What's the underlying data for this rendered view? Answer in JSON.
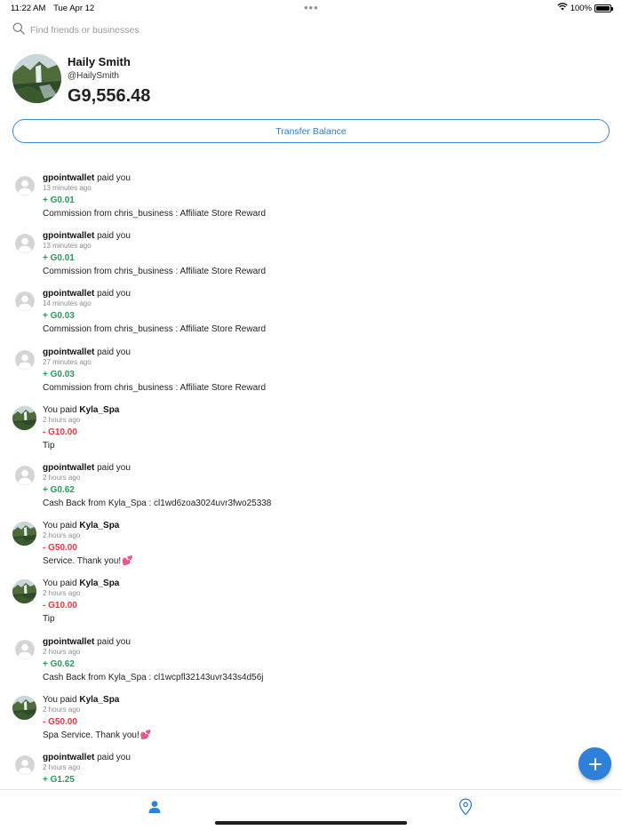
{
  "status_bar": {
    "time": "11:22 AM",
    "date": "Tue Apr 12",
    "dots": "•••",
    "battery": "100%"
  },
  "search": {
    "placeholder": "Find friends or businesses"
  },
  "profile": {
    "name": "Haily Smith",
    "handle": "@HailySmith",
    "balance": "G9,556.48"
  },
  "transfer": {
    "label": "Transfer Balance"
  },
  "transactions": [
    {
      "avatar": "default",
      "actor": "gpointwallet",
      "verb": "paid you",
      "time": "13 minutes ago",
      "amount": "+ G0.01",
      "direction": "positive",
      "note": "Commission from chris_business : Affiliate Store Reward"
    },
    {
      "avatar": "default",
      "actor": "gpointwallet",
      "verb": "paid you",
      "time": "13 minutes ago",
      "amount": "+ G0.01",
      "direction": "positive",
      "note": "Commission from chris_business : Affiliate Store Reward"
    },
    {
      "avatar": "default",
      "actor": "gpointwallet",
      "verb": "paid you",
      "time": "14 minutes ago",
      "amount": "+ G0.03",
      "direction": "positive",
      "note": "Commission from chris_business : Affiliate Store Reward"
    },
    {
      "avatar": "default",
      "actor": "gpointwallet",
      "verb": "paid you",
      "time": "27 minutes ago",
      "amount": "+ G0.03",
      "direction": "positive",
      "note": "Commission from chris_business : Affiliate Store Reward"
    },
    {
      "avatar": "photo",
      "prefix": "You paid",
      "actor": "Kyla_Spa",
      "time": "2 hours ago",
      "amount": "- G10.00",
      "direction": "negative",
      "note": "Tip"
    },
    {
      "avatar": "default",
      "actor": "gpointwallet",
      "verb": "paid you",
      "time": "2 hours ago",
      "amount": "+ G0.62",
      "direction": "positive",
      "note": "Cash Back from Kyla_Spa : cl1wd6zoa3024uvr3fwo25338"
    },
    {
      "avatar": "photo",
      "prefix": "You paid",
      "actor": "Kyla_Spa",
      "time": "2 hours ago",
      "amount": "- G50.00",
      "direction": "negative",
      "note": "Service. Thank you!",
      "emoji": "💕"
    },
    {
      "avatar": "photo",
      "prefix": "You paid",
      "actor": "Kyla_Spa",
      "time": "2 hours ago",
      "amount": "- G10.00",
      "direction": "negative",
      "note": "Tip"
    },
    {
      "avatar": "default",
      "actor": "gpointwallet",
      "verb": "paid you",
      "time": "2 hours ago",
      "amount": "+ G0.62",
      "direction": "positive",
      "note": "Cash Back from Kyla_Spa : cl1wcpfl32143uvr343s4d56j"
    },
    {
      "avatar": "photo",
      "prefix": "You paid",
      "actor": "Kyla_Spa",
      "time": "2 hours ago",
      "amount": "- G50.00",
      "direction": "negative",
      "note": "Spa Service. Thank you!",
      "emoji": "💕"
    },
    {
      "avatar": "default",
      "actor": "gpointwallet",
      "verb": "paid you",
      "time": "2 hours ago",
      "amount": "+ G1.25",
      "direction": "positive",
      "note": ""
    }
  ],
  "tabs": [
    {
      "name": "profile",
      "icon": "person-icon",
      "active": true
    },
    {
      "name": "location",
      "icon": "location-pin-icon",
      "active": false
    }
  ],
  "colors": {
    "accent": "#2f80d8",
    "positive": "#2a9a5c",
    "negative": "#e0383e"
  }
}
